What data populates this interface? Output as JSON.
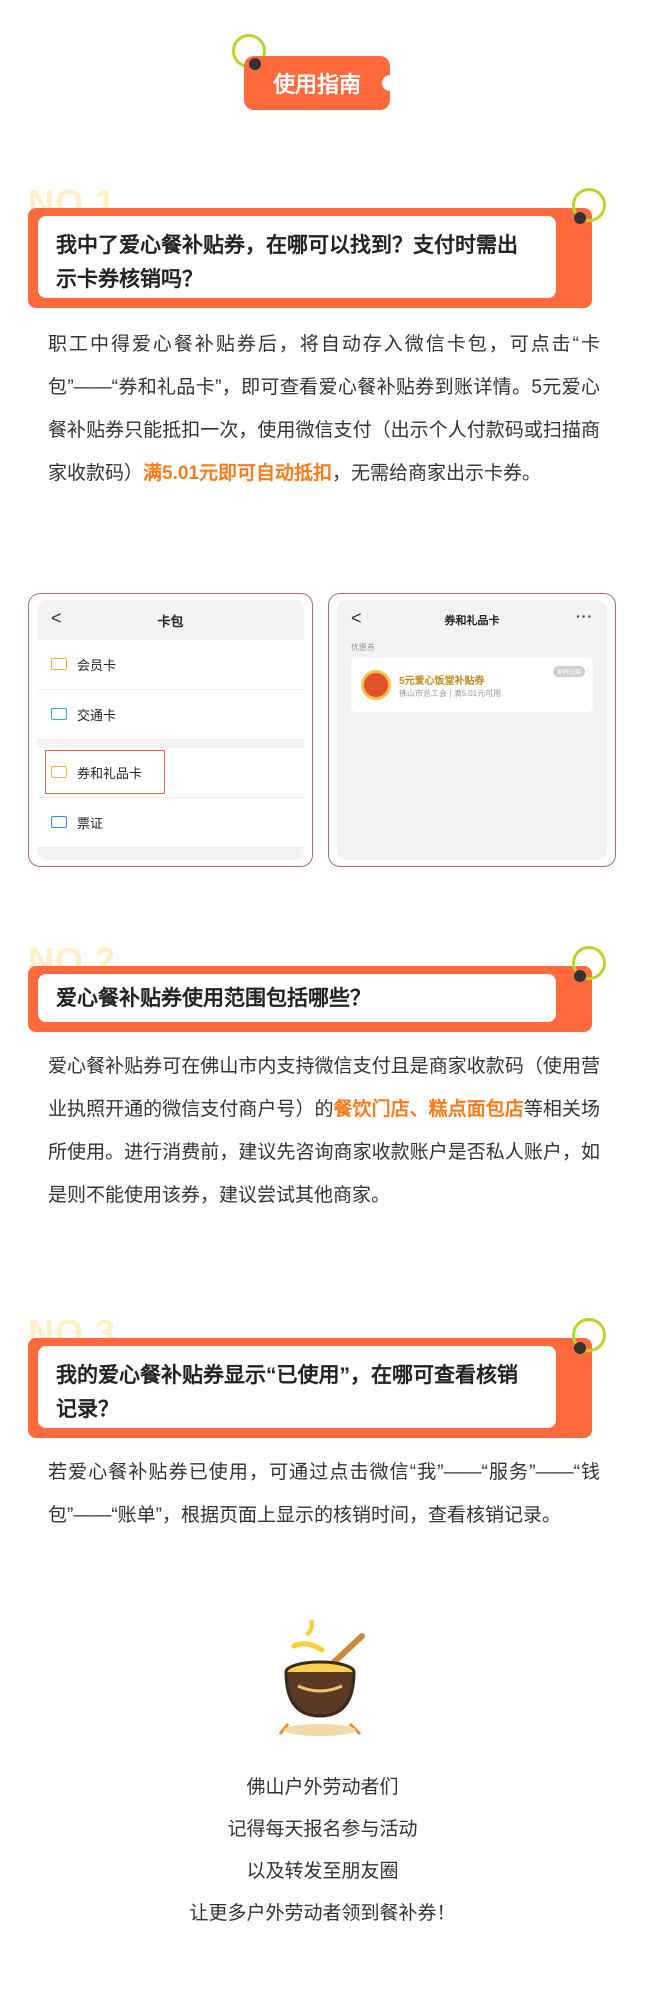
{
  "header": {
    "badge": "使用指南"
  },
  "sections": [
    {
      "no": "NO.1",
      "question": "我中了爱心餐补贴券，在哪可以找到？支付时需出示卡券核销吗？",
      "para_parts": [
        "职工中得爱心餐补贴券后，将自动存入微信卡包，可点击“卡包”——“券和礼品卡”，即可查看爱心餐补贴券到账详情。5元爱心餐补贴券只能抵扣一次，使用微信支付（出示个人付款码或扫描商家收款码）",
        "满5.01元即可自动抵扣",
        "，无需给商家出示卡券。"
      ]
    },
    {
      "no": "NO.2",
      "question": "爱心餐补贴券使用范围包括哪些？",
      "para_parts": [
        "爱心餐补贴券可在佛山市内支持微信支付且是商家收款码（使用营业执照开通的微信支付商户号）的",
        "餐饮门店、糕点面包店",
        "等相关场所使用。进行消费前，建议先咨询商家收款账户是否私人账户，如是则不能使用该券，建议尝试其他商家。"
      ]
    },
    {
      "no": "NO.3",
      "question": "我的爱心餐补贴券显示“已使用”，在哪可查看核销记录？",
      "para": "若爱心餐补贴券已使用，可通过点击微信“我”——“服务”——“钱包”——“账单”，根据页面上显示的核销时间，查看核销记录。"
    }
  ],
  "phone_left": {
    "back": "<",
    "title": "卡包",
    "items": [
      "会员卡",
      "交通卡",
      "券和礼品卡",
      "票证"
    ]
  },
  "phone_right": {
    "back": "<",
    "title": "券和礼品卡",
    "more": "···",
    "category": "优惠券",
    "coupon_title": "5元爱心饭堂补贴券",
    "coupon_sub": "佛山市总工会 | 满5.01元可用",
    "coupon_tag": "即将过期"
  },
  "footer": [
    "佛山户外劳动者们",
    "记得每天报名参与活动",
    "以及转发至朋友圈",
    "让更多户外劳动者领到餐补券！"
  ],
  "colors": {
    "accent": "#ff6a3d",
    "highlight": "#ff7a1a",
    "ring": "#b6d62a"
  }
}
